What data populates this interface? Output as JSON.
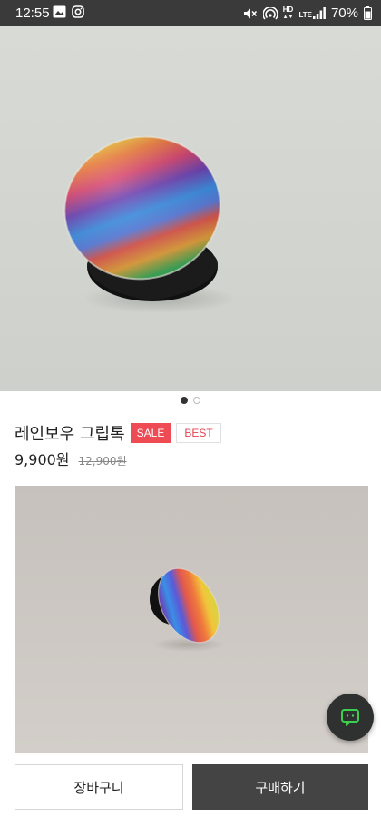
{
  "status_bar": {
    "time": "12:55",
    "battery": "70%",
    "network": "LTE",
    "hd_label": "HD",
    "icons": [
      "gallery-icon",
      "instagram-icon",
      "mute-icon",
      "hotspot-icon",
      "signal-icon",
      "battery-icon"
    ]
  },
  "carousel": {
    "total": 2,
    "active_index": 0
  },
  "product": {
    "title": "레인보우 그립톡",
    "badges": {
      "sale": "SALE",
      "best": "BEST"
    },
    "price": "9,900원",
    "original_price": "12,900원"
  },
  "actions": {
    "cart_label": "장바구니",
    "buy_label": "구매하기"
  },
  "colors": {
    "status_bar": "#3a3a3a",
    "sale_badge": "#ee4b55",
    "buy_button": "#444444",
    "chat_fab": "#2f3130",
    "chat_icon": "#3ccf4e"
  }
}
